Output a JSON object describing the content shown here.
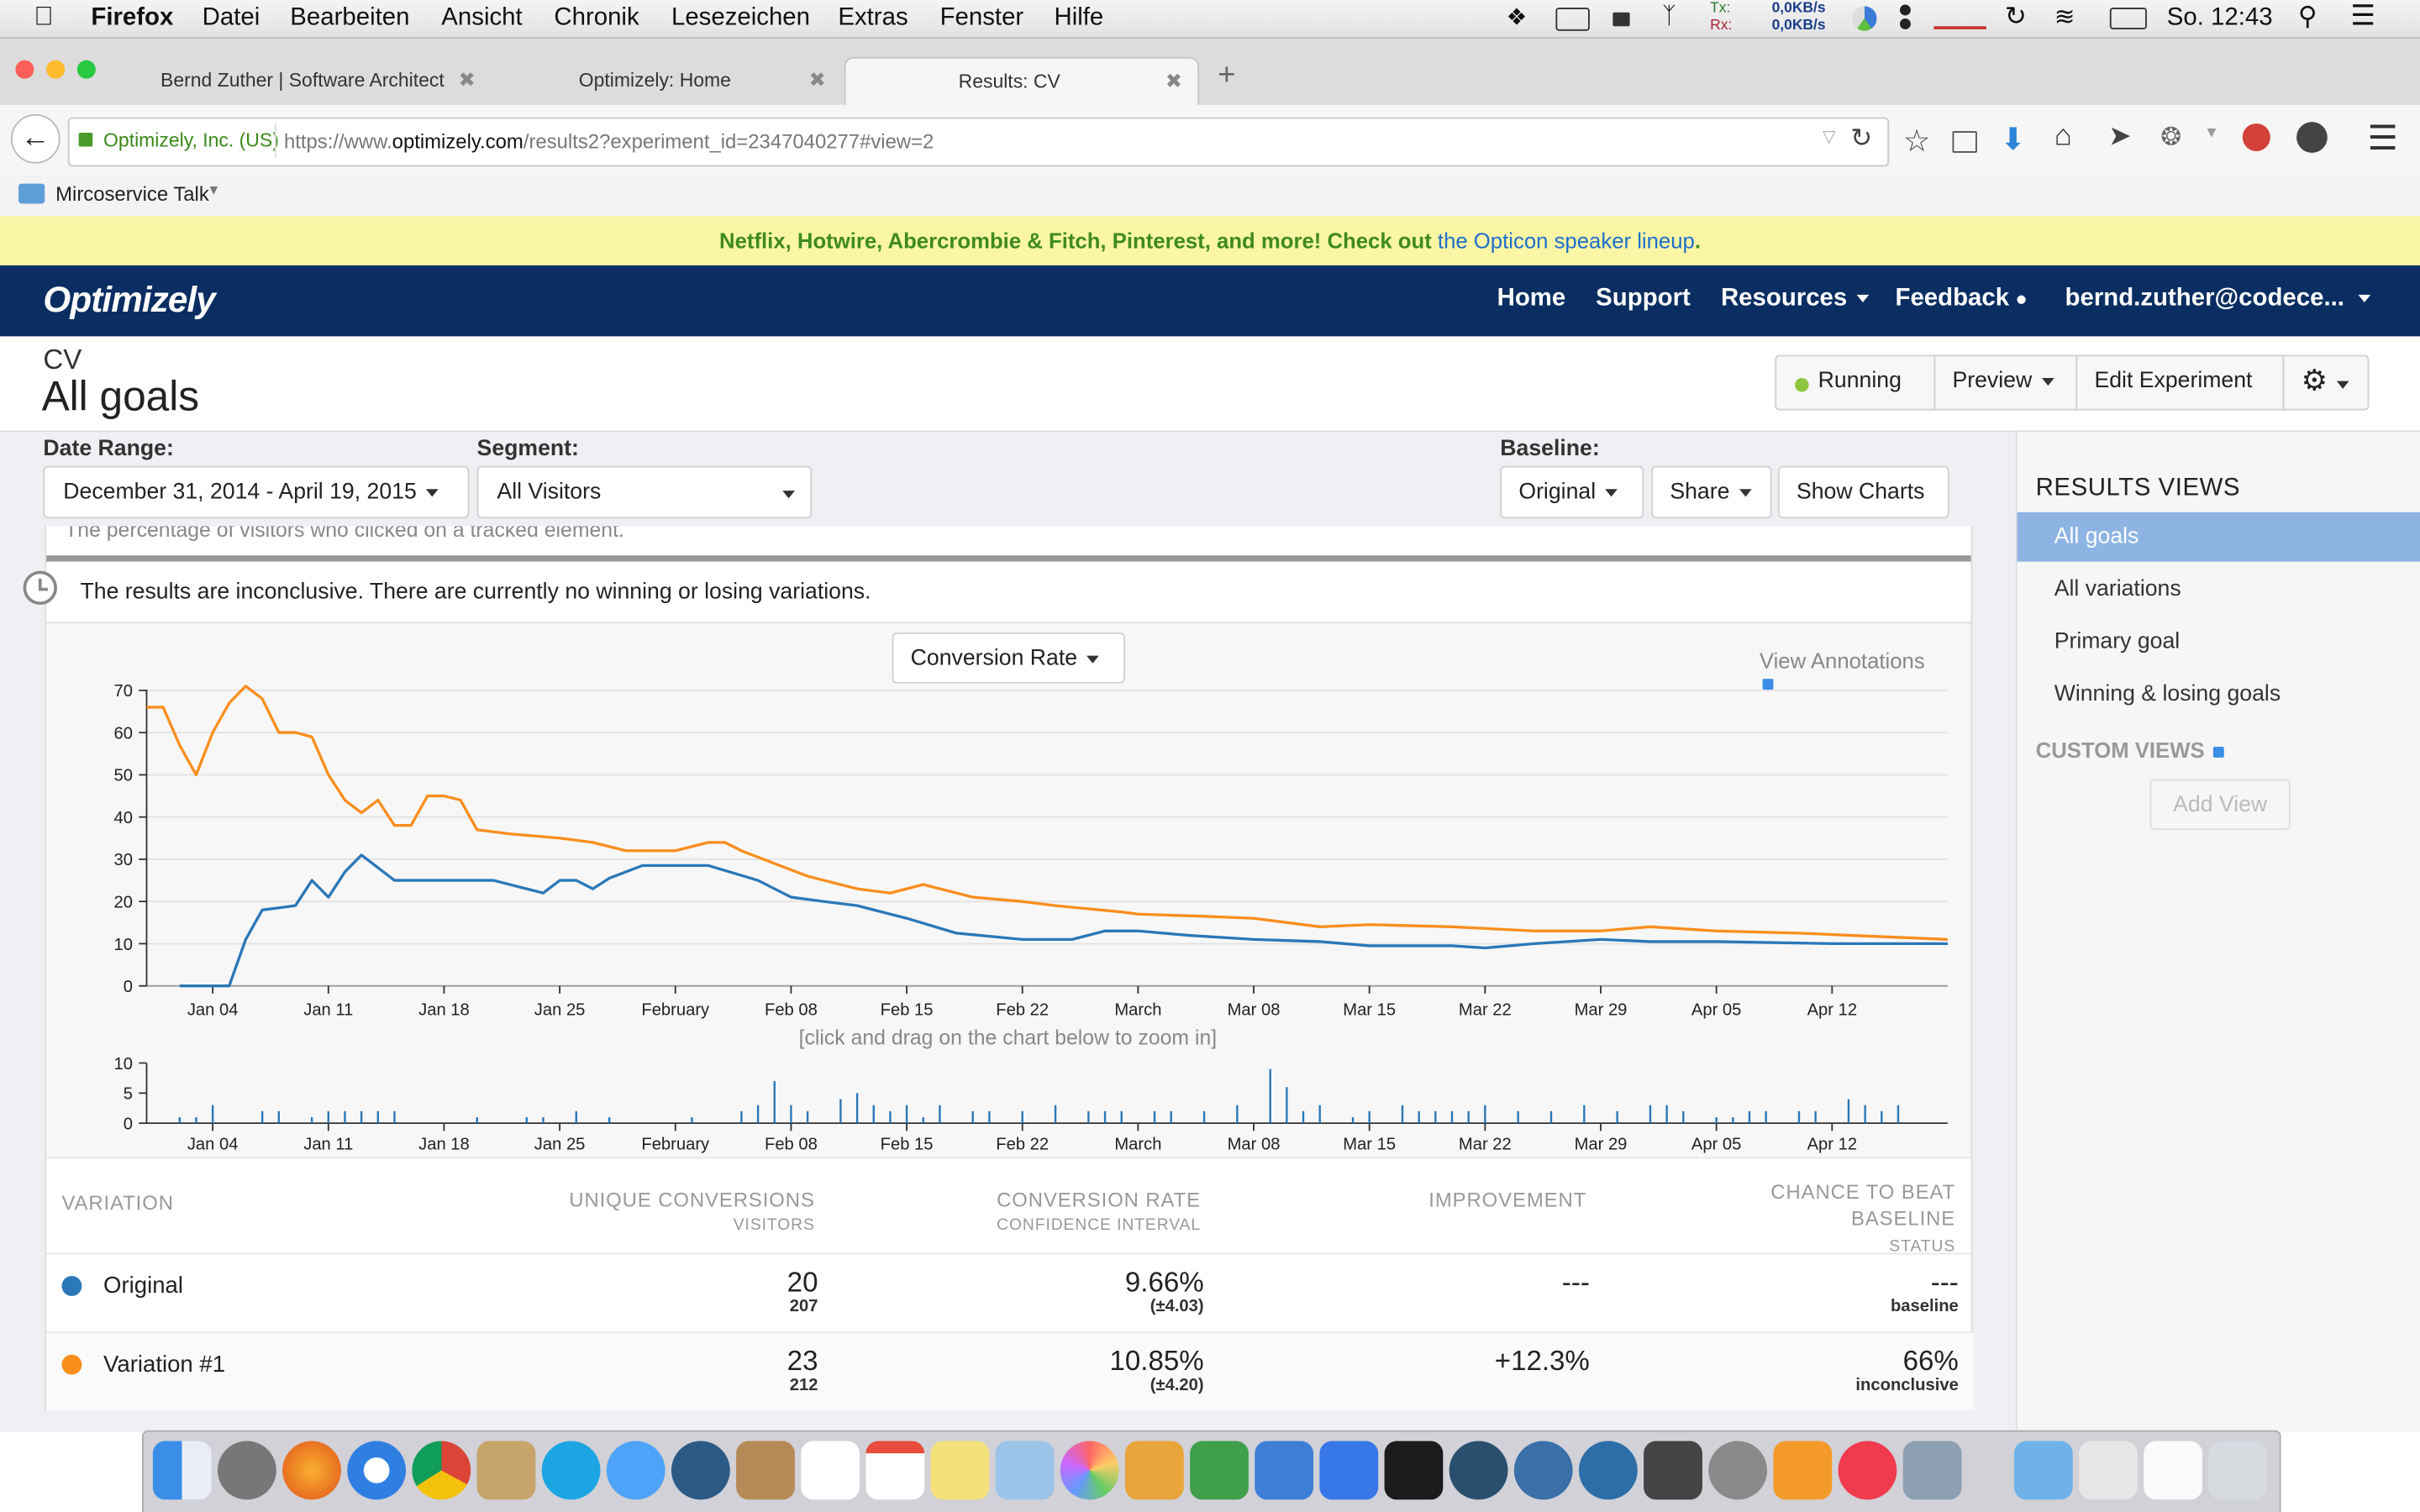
{
  "menubar": {
    "app": "Firefox",
    "items": [
      "Datei",
      "Bearbeiten",
      "Ansicht",
      "Chronik",
      "Lesezeichen",
      "Extras",
      "Fenster",
      "Hilfe"
    ],
    "net_tx_label": "Tx:",
    "net_rx_label": "Rx:",
    "net_tx": "0,0KB/s",
    "net_rx": "0,0KB/s",
    "clock": "So. 12:43"
  },
  "tabs": [
    {
      "label": "Bernd Zuther | Software Architect"
    },
    {
      "label": "Optimizely: Home"
    },
    {
      "label": "Results: CV"
    }
  ],
  "address": {
    "site_identity": "Optimizely, Inc. (US)",
    "url_prefix": "https://www.",
    "url_domain": "optimizely.com",
    "url_path": "/results2?experiment_id=2347040277#view=2"
  },
  "bookmarks": {
    "folder": "Mircoservice Talk"
  },
  "banner": {
    "text": "Netflix, Hotwire, Abercrombie & Fitch, Pinterest, and more! Check out ",
    "link": "the Opticon speaker lineup",
    "suffix": "."
  },
  "optnav": {
    "logo": "Optimizely",
    "items": [
      "Home",
      "Support",
      "Resources",
      "Feedback"
    ],
    "user": "bernd.zuther@codece..."
  },
  "experiment": {
    "name": "CV",
    "view_title": "All goals",
    "status": "Running",
    "preview": "Preview",
    "edit": "Edit Experiment"
  },
  "filters": {
    "date_range_label": "Date Range:",
    "date_range_value": "December 31, 2014 - April 19, 2015",
    "segment_label": "Segment:",
    "segment_value": "All Visitors",
    "baseline_label": "Baseline:",
    "baseline_value": "Original",
    "share": "Share",
    "show_charts": "Show Charts"
  },
  "goal": {
    "description": "The percentage of visitors who clicked on a tracked element.",
    "result_message": "The results are inconclusive. There are currently no winning or losing variations.",
    "metric_select": "Conversion Rate",
    "view_annotations": "View Annotations",
    "zoom_hint": "[click and drag on the chart below to zoom in]"
  },
  "colors": {
    "original": "#2a78b8",
    "variation": "#f98e1d",
    "navy": "#0a2e61",
    "sidebar_active": "#8db4e3",
    "banner_bg": "#fbf6a6",
    "banner_text": "#3f8b1d"
  },
  "chart_data": [
    {
      "type": "line",
      "x_ticks": [
        "Jan 04",
        "Jan 11",
        "Jan 18",
        "Jan 25",
        "February",
        "Feb 08",
        "Feb 15",
        "Feb 22",
        "March",
        "Mar 08",
        "Mar 15",
        "Mar 22",
        "Mar 29",
        "Apr 05",
        "Apr 12"
      ],
      "x_range": [
        "2014-12-31",
        "2015-04-19"
      ],
      "yticks": [
        0,
        10,
        20,
        30,
        40,
        50,
        60,
        70
      ],
      "ylim": [
        0,
        72
      ],
      "grid": true,
      "series": [
        {
          "name": "Original",
          "points": [
            [
              "2015-01-02",
              0
            ],
            [
              "2015-01-03",
              0
            ],
            [
              "2015-01-04",
              0
            ],
            [
              "2015-01-05",
              0
            ],
            [
              "2015-01-06",
              11
            ],
            [
              "2015-01-07",
              18
            ],
            [
              "2015-01-08",
              18.5
            ],
            [
              "2015-01-09",
              19
            ],
            [
              "2015-01-10",
              25
            ],
            [
              "2015-01-11",
              21
            ],
            [
              "2015-01-12",
              27
            ],
            [
              "2015-01-13",
              31
            ],
            [
              "2015-01-14",
              28
            ],
            [
              "2015-01-15",
              25
            ],
            [
              "2015-01-18",
              25
            ],
            [
              "2015-01-21",
              25
            ],
            [
              "2015-01-23",
              23
            ],
            [
              "2015-01-24",
              22
            ],
            [
              "2015-01-25",
              25
            ],
            [
              "2015-01-26",
              25
            ],
            [
              "2015-01-27",
              23
            ],
            [
              "2015-01-28",
              25.5
            ],
            [
              "2015-01-30",
              28.5
            ],
            [
              "2015-02-03",
              28.5
            ],
            [
              "2015-02-06",
              25
            ],
            [
              "2015-02-08",
              21
            ],
            [
              "2015-02-10",
              20
            ],
            [
              "2015-02-12",
              19
            ],
            [
              "2015-02-15",
              16
            ],
            [
              "2015-02-18",
              12.5
            ],
            [
              "2015-02-22",
              11
            ],
            [
              "2015-02-25",
              11
            ],
            [
              "2015-02-27",
              13
            ],
            [
              "2015-03-01",
              13
            ],
            [
              "2015-03-04",
              12
            ],
            [
              "2015-03-08",
              11
            ],
            [
              "2015-03-12",
              10.5
            ],
            [
              "2015-03-15",
              9.5
            ],
            [
              "2015-03-20",
              9.5
            ],
            [
              "2015-03-22",
              9
            ],
            [
              "2015-03-25",
              10
            ],
            [
              "2015-03-29",
              11
            ],
            [
              "2015-04-01",
              10.5
            ],
            [
              "2015-04-05",
              10.5
            ],
            [
              "2015-04-12",
              10
            ],
            [
              "2015-04-19",
              10
            ]
          ]
        },
        {
          "name": "Variation #1",
          "points": [
            [
              "2014-12-31",
              66
            ],
            [
              "2015-01-01",
              66
            ],
            [
              "2015-01-02",
              57
            ],
            [
              "2015-01-03",
              50
            ],
            [
              "2015-01-04",
              60
            ],
            [
              "2015-01-05",
              67
            ],
            [
              "2015-01-06",
              71
            ],
            [
              "2015-01-07",
              68
            ],
            [
              "2015-01-08",
              60
            ],
            [
              "2015-01-09",
              60
            ],
            [
              "2015-01-10",
              59
            ],
            [
              "2015-01-11",
              50
            ],
            [
              "2015-01-12",
              44
            ],
            [
              "2015-01-13",
              41
            ],
            [
              "2015-01-14",
              44
            ],
            [
              "2015-01-15",
              38
            ],
            [
              "2015-01-16",
              38
            ],
            [
              "2015-01-17",
              45
            ],
            [
              "2015-01-18",
              45
            ],
            [
              "2015-01-19",
              44
            ],
            [
              "2015-01-20",
              37
            ],
            [
              "2015-01-22",
              36
            ],
            [
              "2015-01-25",
              35
            ],
            [
              "2015-01-27",
              34
            ],
            [
              "2015-01-29",
              32
            ],
            [
              "2015-02-01",
              32
            ],
            [
              "2015-02-03",
              34
            ],
            [
              "2015-02-04",
              34
            ],
            [
              "2015-02-05",
              32
            ],
            [
              "2015-02-07",
              29
            ],
            [
              "2015-02-09",
              26
            ],
            [
              "2015-02-12",
              23
            ],
            [
              "2015-02-14",
              22
            ],
            [
              "2015-02-16",
              24
            ],
            [
              "2015-02-19",
              21
            ],
            [
              "2015-02-22",
              20
            ],
            [
              "2015-02-24",
              19
            ],
            [
              "2015-02-28",
              17.5
            ],
            [
              "2015-03-01",
              17
            ],
            [
              "2015-03-05",
              16.5
            ],
            [
              "2015-03-08",
              16
            ],
            [
              "2015-03-12",
              14
            ],
            [
              "2015-03-15",
              14.5
            ],
            [
              "2015-03-20",
              14
            ],
            [
              "2015-03-25",
              13
            ],
            [
              "2015-03-29",
              13
            ],
            [
              "2015-04-01",
              14
            ],
            [
              "2015-04-05",
              13
            ],
            [
              "2015-04-10",
              12.5
            ],
            [
              "2015-04-13",
              12
            ],
            [
              "2015-04-19",
              11
            ]
          ]
        }
      ]
    },
    {
      "type": "bar",
      "x_ticks": [
        "Jan 04",
        "Jan 11",
        "Jan 18",
        "Jan 25",
        "February",
        "Feb 08",
        "Feb 15",
        "Feb 22",
        "March",
        "Mar 08",
        "Mar 15",
        "Mar 22",
        "Mar 29",
        "Apr 05",
        "Apr 12"
      ],
      "x_range": [
        "2014-12-31",
        "2015-04-19"
      ],
      "yticks": [
        0,
        5,
        10
      ],
      "ylim": [
        0,
        10
      ],
      "series": [
        {
          "name": "Visitors",
          "points": [
            [
              "2015-01-02",
              1
            ],
            [
              "2015-01-03",
              1
            ],
            [
              "2015-01-04",
              3
            ],
            [
              "2015-01-07",
              2
            ],
            [
              "2015-01-08",
              2
            ],
            [
              "2015-01-10",
              1
            ],
            [
              "2015-01-11",
              2
            ],
            [
              "2015-01-12",
              2
            ],
            [
              "2015-01-13",
              2
            ],
            [
              "2015-01-14",
              2
            ],
            [
              "2015-01-15",
              2
            ],
            [
              "2015-01-20",
              1
            ],
            [
              "2015-01-23",
              1
            ],
            [
              "2015-01-24",
              1
            ],
            [
              "2015-01-26",
              2
            ],
            [
              "2015-01-28",
              1
            ],
            [
              "2015-02-02",
              1
            ],
            [
              "2015-02-05",
              2
            ],
            [
              "2015-02-06",
              3
            ],
            [
              "2015-02-07",
              7
            ],
            [
              "2015-02-08",
              3
            ],
            [
              "2015-02-09",
              2
            ],
            [
              "2015-02-11",
              4
            ],
            [
              "2015-02-12",
              5
            ],
            [
              "2015-02-13",
              3
            ],
            [
              "2015-02-14",
              2
            ],
            [
              "2015-02-15",
              3
            ],
            [
              "2015-02-16",
              1
            ],
            [
              "2015-02-17",
              3
            ],
            [
              "2015-02-19",
              2
            ],
            [
              "2015-02-20",
              2
            ],
            [
              "2015-02-22",
              2
            ],
            [
              "2015-02-24",
              3
            ],
            [
              "2015-02-26",
              2
            ],
            [
              "2015-02-27",
              2
            ],
            [
              "2015-02-28",
              2
            ],
            [
              "2015-03-02",
              2
            ],
            [
              "2015-03-03",
              2
            ],
            [
              "2015-03-05",
              2
            ],
            [
              "2015-03-07",
              3
            ],
            [
              "2015-03-09",
              9
            ],
            [
              "2015-03-10",
              6
            ],
            [
              "2015-03-11",
              2
            ],
            [
              "2015-03-12",
              3
            ],
            [
              "2015-03-14",
              1
            ],
            [
              "2015-03-15",
              2
            ],
            [
              "2015-03-17",
              3
            ],
            [
              "2015-03-18",
              2
            ],
            [
              "2015-03-19",
              2
            ],
            [
              "2015-03-20",
              2
            ],
            [
              "2015-03-21",
              2
            ],
            [
              "2015-03-22",
              3
            ],
            [
              "2015-03-24",
              2
            ],
            [
              "2015-03-26",
              2
            ],
            [
              "2015-03-28",
              3
            ],
            [
              "2015-03-30",
              2
            ],
            [
              "2015-04-01",
              3
            ],
            [
              "2015-04-02",
              3
            ],
            [
              "2015-04-03",
              2
            ],
            [
              "2015-04-05",
              1
            ],
            [
              "2015-04-06",
              1
            ],
            [
              "2015-04-07",
              2
            ],
            [
              "2015-04-08",
              2
            ],
            [
              "2015-04-10",
              2
            ],
            [
              "2015-04-11",
              2
            ],
            [
              "2015-04-13",
              4
            ],
            [
              "2015-04-14",
              3
            ],
            [
              "2015-04-15",
              2
            ],
            [
              "2015-04-16",
              3
            ]
          ]
        }
      ]
    },
    {
      "type": "table",
      "columns": [
        {
          "title": "VARIATION",
          "subtitle": ""
        },
        {
          "title": "UNIQUE CONVERSIONS",
          "subtitle": "VISITORS"
        },
        {
          "title": "CONVERSION RATE",
          "subtitle": "CONFIDENCE INTERVAL"
        },
        {
          "title": "IMPROVEMENT",
          "subtitle": ""
        },
        {
          "title": "CHANCE TO BEAT",
          "title2": "BASELINE",
          "subtitle": "STATUS"
        }
      ],
      "rows": [
        {
          "name": "Original",
          "conversions": "20",
          "visitors": "207",
          "rate": "9.66%",
          "interval": "(±4.03)",
          "improvement": "---",
          "chance": "---",
          "status": "baseline"
        },
        {
          "name": "Variation #1",
          "conversions": "23",
          "visitors": "212",
          "rate": "10.85%",
          "interval": "(±4.20)",
          "improvement": "+12.3%",
          "chance": "66%",
          "status": "inconclusive"
        }
      ]
    }
  ],
  "sidebar": {
    "title": "RESULTS VIEWS",
    "items": [
      "All goals",
      "All variations",
      "Primary goal",
      "Winning & losing goals"
    ],
    "custom_title": "CUSTOM VIEWS",
    "add_view": "Add View"
  }
}
